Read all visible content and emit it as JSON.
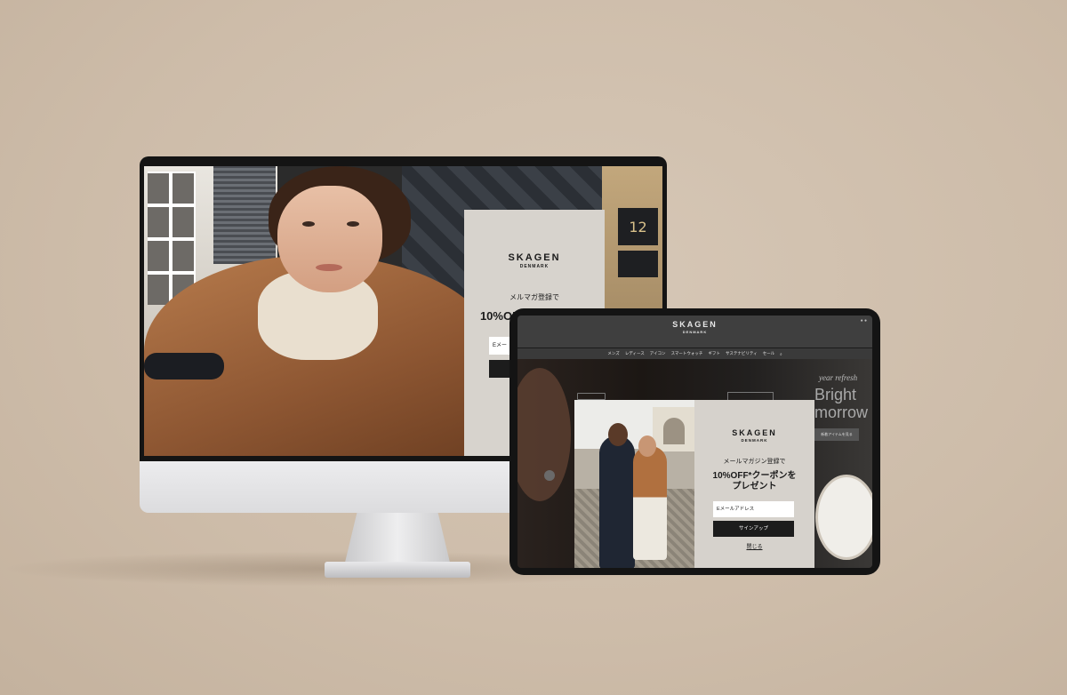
{
  "imac": {
    "door_number": "12",
    "popup": {
      "brand": "SKAGEN",
      "brand_sub": "DENMARK",
      "lead": "メルマガ登録で",
      "offer_line1": "10%OFF*クーポンを",
      "offer_line2": "プ",
      "email_placeholder": "Eメー"
    }
  },
  "ipad": {
    "header": {
      "brand": "SKAGEN",
      "brand_sub": "DENMARK",
      "status": "● ●"
    },
    "nav": {
      "items": [
        {
          "label": "メンズ"
        },
        {
          "label": "レディース"
        },
        {
          "label": "アイコン"
        },
        {
          "label": "スマートウォッチ"
        },
        {
          "label": "ギフト"
        },
        {
          "label": "サステナビリティ"
        },
        {
          "label": "セール"
        }
      ],
      "search_icon": "⌕"
    },
    "hero": {
      "tagline": "year refresh",
      "headline_line1": "Bright",
      "headline_line2": "morrow",
      "button": "新着アイテムを見る"
    },
    "modal": {
      "brand": "SKAGEN",
      "brand_sub": "DENMARK",
      "lead": "メールマガジン登録で",
      "offer_line1": "10%OFF*クーポンを",
      "offer_line2": "プレゼント",
      "email_placeholder": "Eメールアドレス",
      "signup_label": "サインアップ",
      "close_label": "閉じる"
    }
  }
}
